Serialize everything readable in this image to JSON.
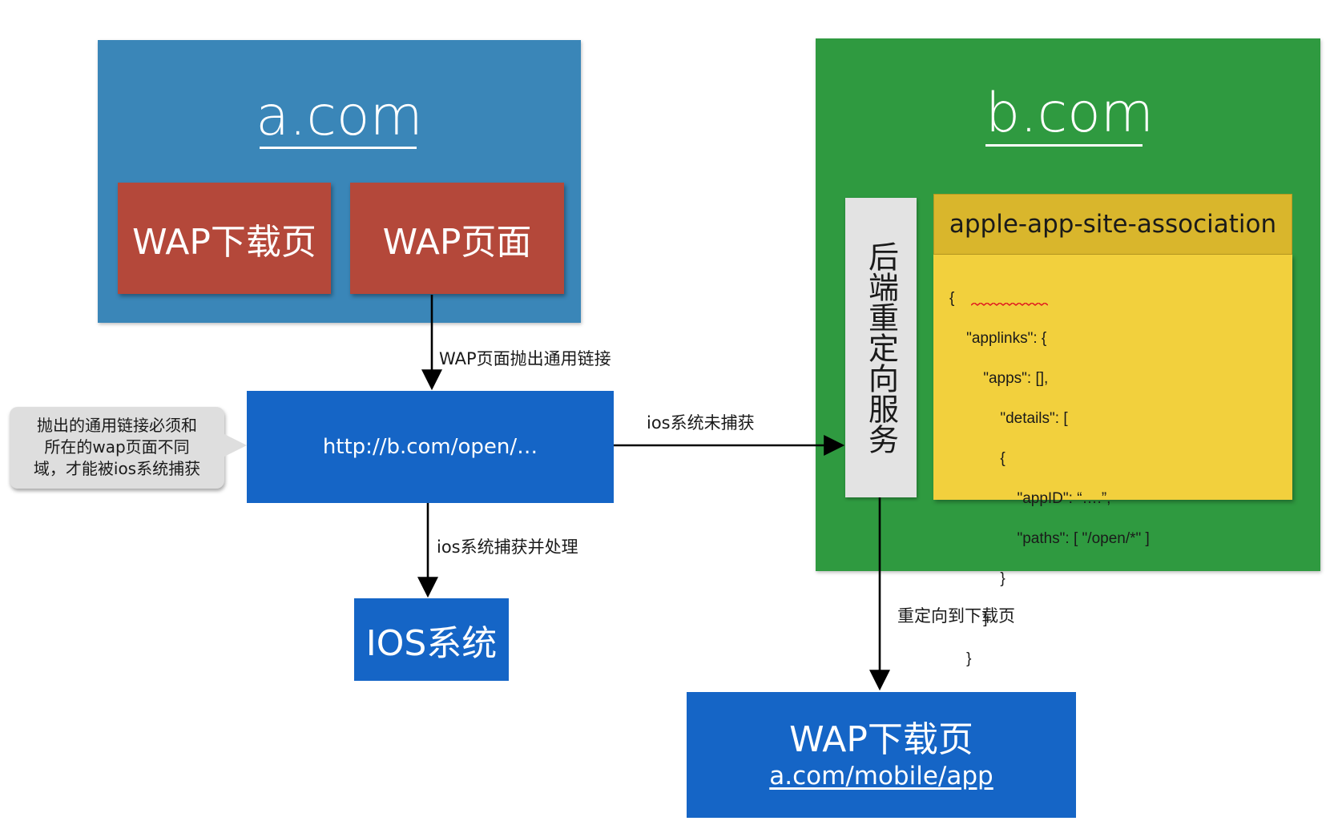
{
  "domain_a": {
    "title": "a.com",
    "download_page": "WAP下载页",
    "wap_page": "WAP页面"
  },
  "universal_link": {
    "url": "http://b.com/open/…"
  },
  "ios_system": {
    "label": "IOS系统"
  },
  "domain_b": {
    "title": "b.com",
    "backend_service": "后端重定向服务",
    "aasa": {
      "filename": "apple-app-site-association",
      "lines": [
        "{",
        "    \"applinks\": {",
        "        \"apps\": [],",
        "            \"details\": [",
        "            {",
        "                \"appID\": “….”,",
        "                \"paths\": [ \"/open/*\" ]",
        "            }",
        "        ]",
        "    }",
        "}"
      ]
    }
  },
  "target_download": {
    "title": "WAP下载页",
    "url": "a.com/mobile/app"
  },
  "edges": {
    "wap_throw": "WAP页面抛出通用链接",
    "ios_not_captured": "ios系统未捕获",
    "ios_captured": "ios系统捕获并处理",
    "redirect": "重定向到下载页"
  },
  "callout": {
    "lines": [
      "抛出的通用链接必须和",
      "所在的wap页面不同",
      "域，才能被ios系统捕获"
    ]
  }
}
